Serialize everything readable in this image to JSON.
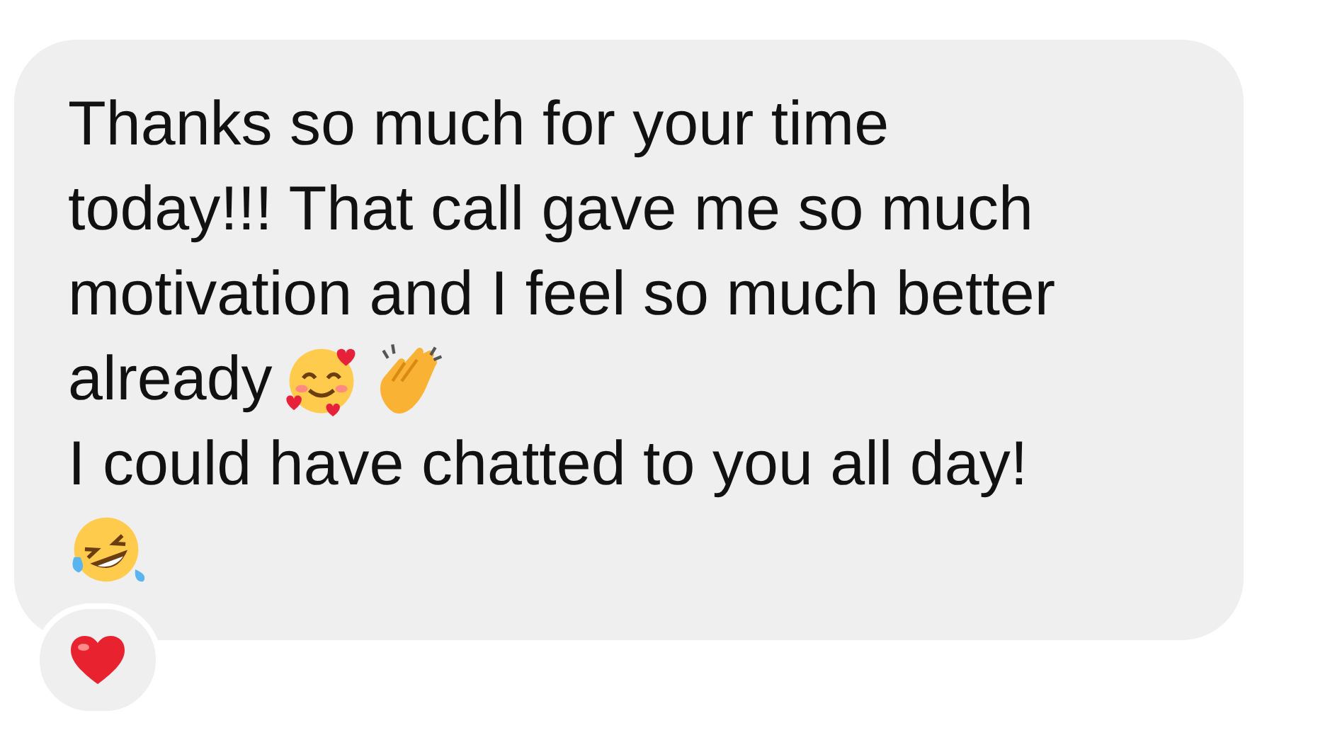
{
  "message": {
    "lines": [
      {
        "text": "Thanks so much for your time"
      },
      {
        "text": "today!!! That call gave me so much"
      },
      {
        "text": "motivation and I feel so much better"
      },
      {
        "text": "already",
        "emojis": [
          {
            "kind": "smiling_hearts"
          },
          {
            "kind": "clapping"
          }
        ]
      },
      {
        "text": "I could have chatted to you all day!"
      },
      {
        "emojis": [
          {
            "kind": "laughing"
          }
        ]
      }
    ]
  },
  "reaction": {
    "kind": "heart"
  }
}
